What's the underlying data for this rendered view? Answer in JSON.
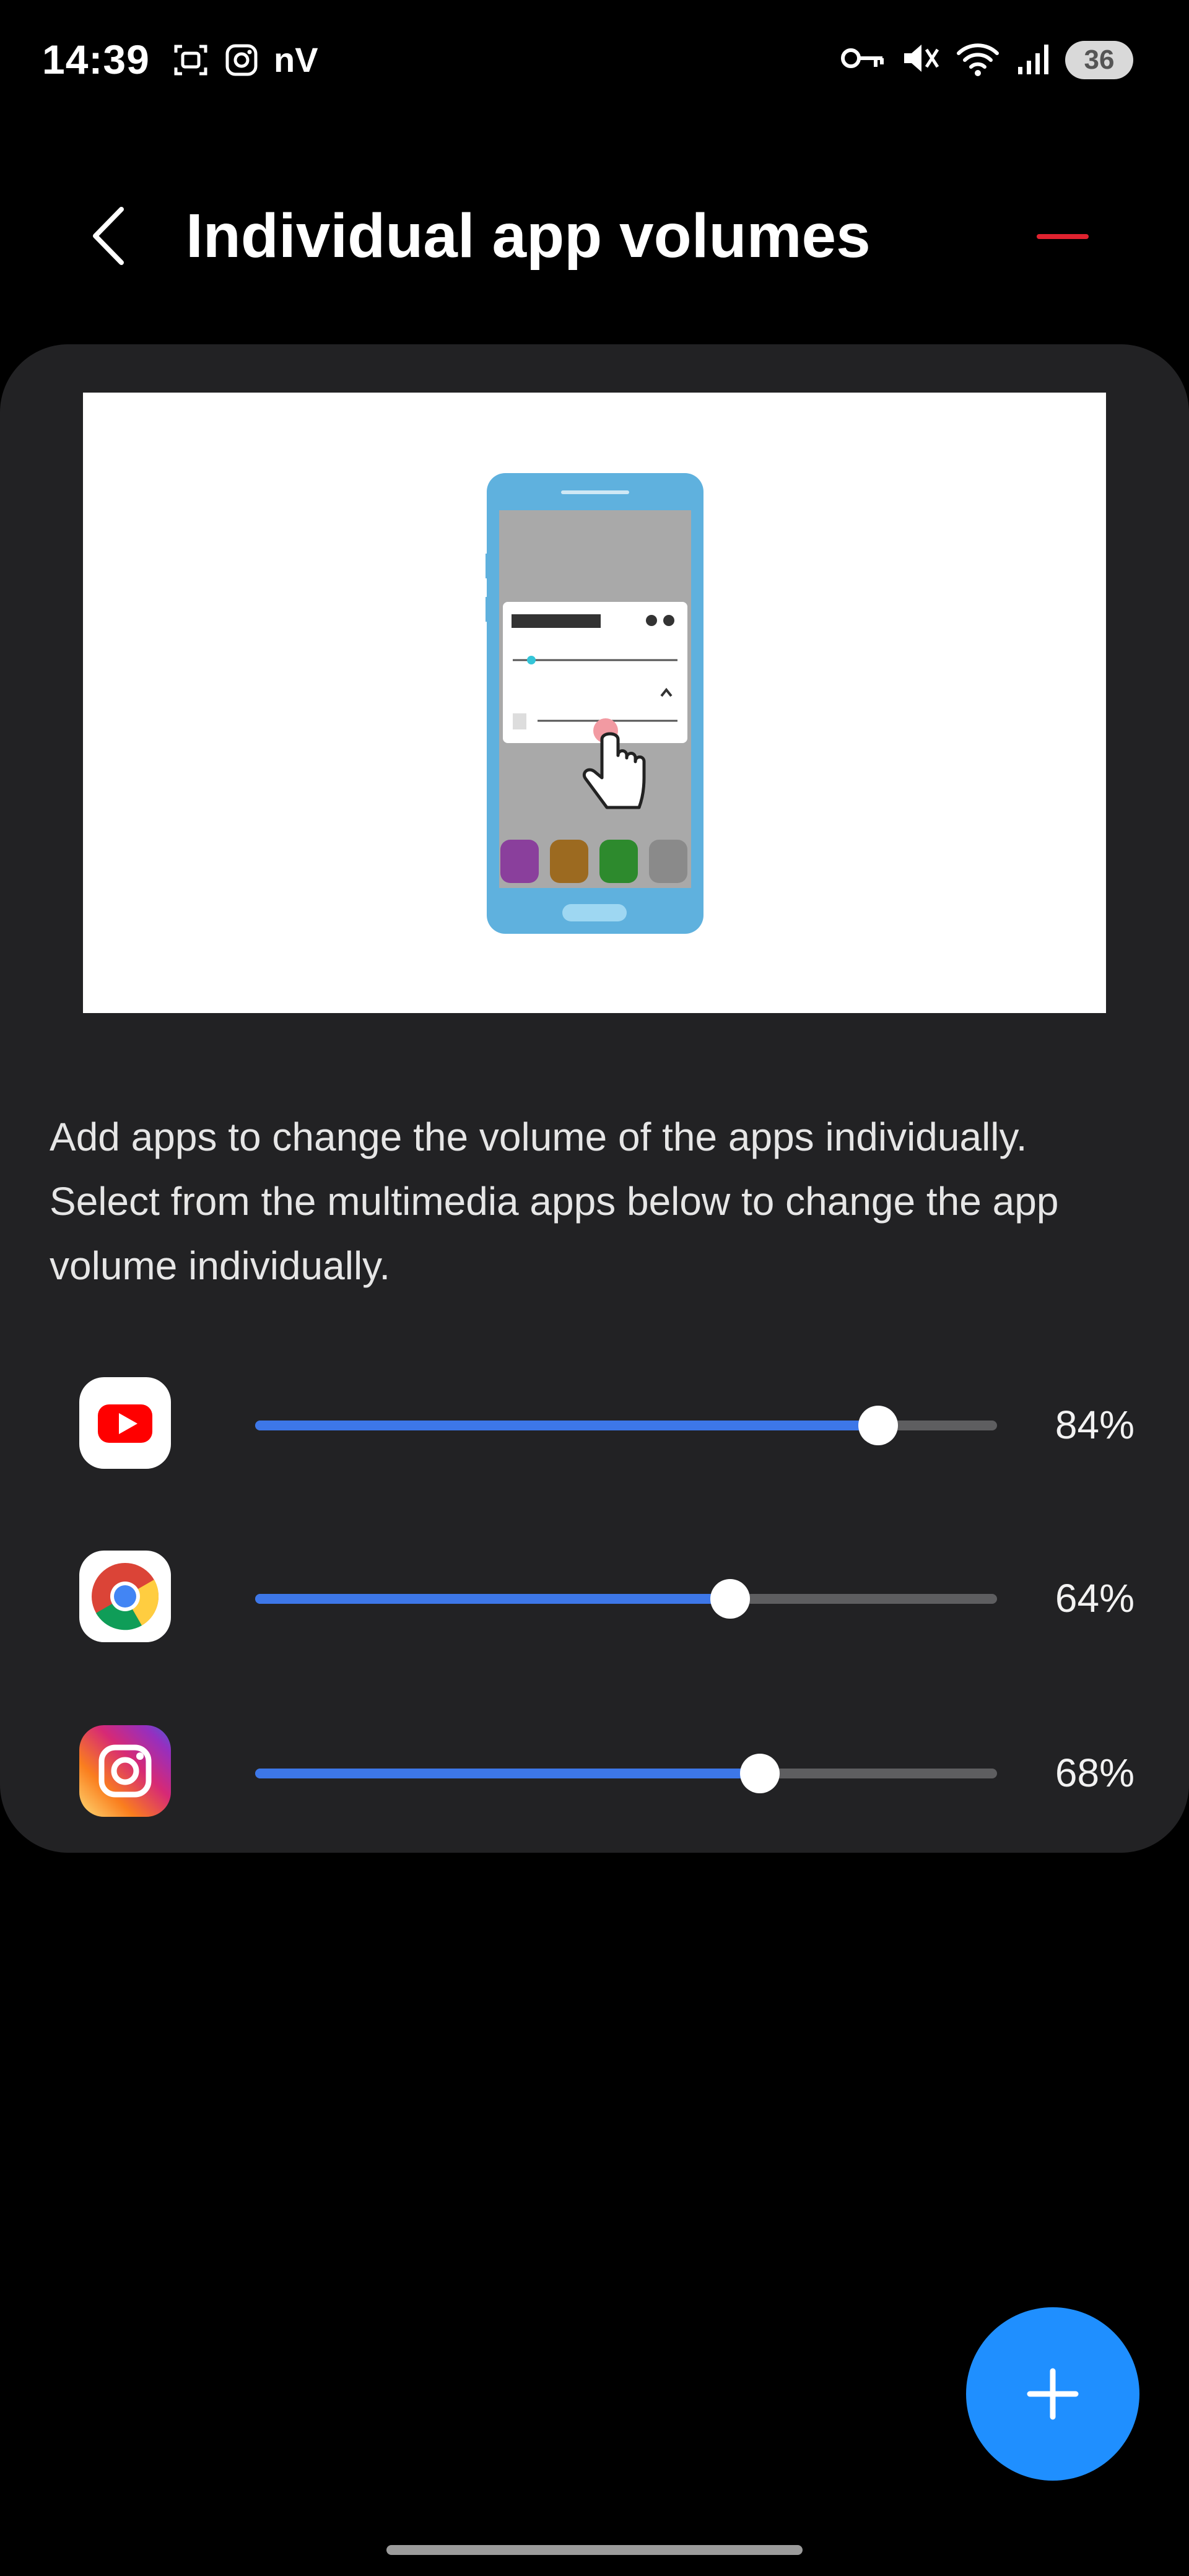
{
  "status": {
    "time": "14:39",
    "nv_text": "nV",
    "battery": "36",
    "icons_left": [
      "screenshot-icon",
      "instagram-notification-icon"
    ],
    "icons_right": [
      "vpn-key-icon",
      "mute-icon",
      "wifi-icon",
      "signal-icon",
      "battery-icon"
    ]
  },
  "header": {
    "title": "Individual app volumes",
    "back_icon": "back-chevron-icon",
    "accent": "#e0222f"
  },
  "illustration": {
    "icon": "phone-volume-illustration"
  },
  "description": "Add apps to change the volume of the apps individually. Select from the multimedia apps below to change the app volume individually.",
  "apps": [
    {
      "icon": "youtube-icon",
      "volume": 0.84,
      "label": "84%"
    },
    {
      "icon": "chrome-icon",
      "volume": 0.64,
      "label": "64%"
    },
    {
      "icon": "instagram-icon",
      "volume": 0.68,
      "label": "68%"
    }
  ],
  "fab": {
    "icon": "plus-icon",
    "color": "#1f8fff"
  },
  "colors": {
    "slider_fill": "#3d77e8",
    "slider_track": "#5e5e60",
    "card": "#222224"
  }
}
